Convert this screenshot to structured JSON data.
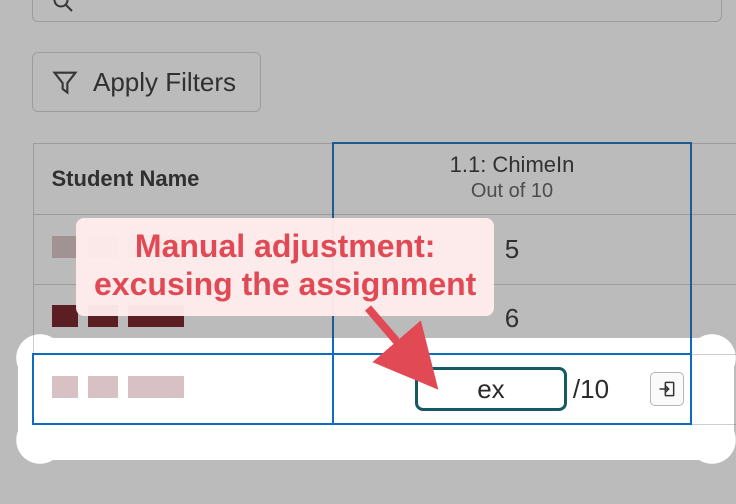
{
  "toolbar": {
    "apply_filters_label": "Apply Filters"
  },
  "table": {
    "student_header": "Student Name",
    "assignment": {
      "title": "1.1: ChimeIn",
      "subtitle": "Out of 10"
    },
    "rows": [
      {
        "score_display": "5"
      },
      {
        "score_display": "6"
      },
      {
        "input_value": "ex",
        "denominator": "/10"
      }
    ]
  },
  "annotation": {
    "line1": "Manual adjustment:",
    "line2": "excusing the assignment"
  },
  "colors": {
    "accent_blue": "#0d6cbf",
    "input_border": "#155a63",
    "annotation_red": "#e14a55"
  }
}
